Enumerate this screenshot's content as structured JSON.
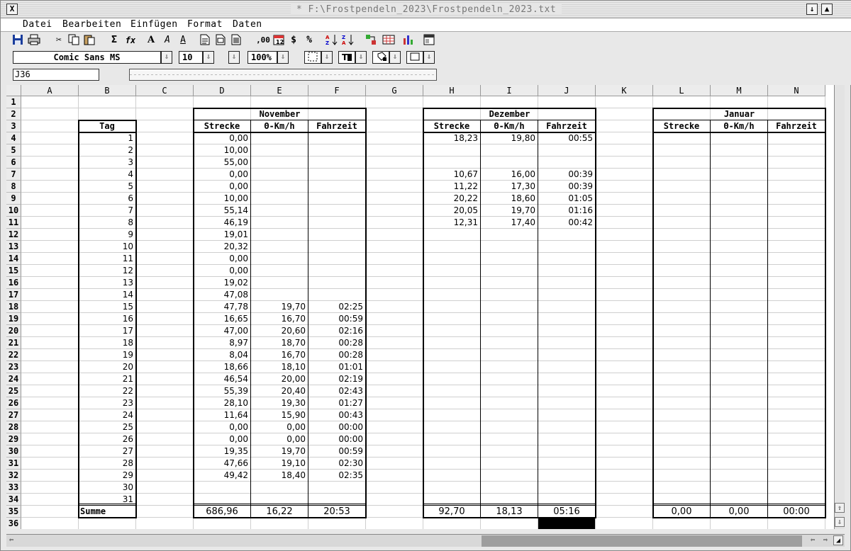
{
  "window": {
    "title": "* F:\\Frostpendeln_2023\\Frostpendeln_2023.txt",
    "close_glyph": "X",
    "iconify_glyph": "↓",
    "fulltoggle_glyph": "▲",
    "resize_glyph": "◢"
  },
  "menubar": [
    "Datei",
    "Bearbeiten",
    "Einfügen",
    "Format",
    "Daten"
  ],
  "toolbar": {
    "icons": [
      "save-icon",
      "print-icon",
      "cut-icon",
      "copy-icon",
      "paste-icon",
      "sum-icon",
      "function-icon",
      "bold-icon",
      "italic-icon",
      "outline-icon",
      "new-sheet-icon",
      "sheet-icon",
      "sheet-list-icon",
      "decimal-icon",
      "date-icon",
      "currency-icon",
      "percent-icon",
      "sort-asc-icon",
      "sort-desc-icon",
      "fill-icon",
      "table-icon",
      "chart-icon",
      "window-icon"
    ],
    "decimal_text": ",00",
    "currency_text": "$",
    "percent_text": "%"
  },
  "formatbar": {
    "font": "Comic Sans MS",
    "size": "10",
    "zoom": "100%",
    "dropdown_arrow": "⇩"
  },
  "cellbar": {
    "cell_ref": "J36",
    "formula": ""
  },
  "columns": [
    "A",
    "B",
    "C",
    "D",
    "E",
    "F",
    "G",
    "H",
    "I",
    "J",
    "K",
    "L",
    "M",
    "N"
  ],
  "rows": [
    "1",
    "2",
    "3",
    "4",
    "5",
    "6",
    "7",
    "8",
    "9",
    "10",
    "11",
    "12",
    "13",
    "14",
    "15",
    "16",
    "17",
    "18",
    "19",
    "20",
    "21",
    "22",
    "23",
    "24",
    "25",
    "26",
    "27",
    "28",
    "29",
    "30",
    "31",
    "32",
    "33",
    "34",
    "35",
    "36"
  ],
  "sheet": {
    "tag_header": "Tag",
    "sum_label": "Summe",
    "tage": [
      "1",
      "2",
      "3",
      "4",
      "5",
      "6",
      "7",
      "8",
      "9",
      "10",
      "11",
      "12",
      "13",
      "14",
      "15",
      "16",
      "17",
      "18",
      "19",
      "20",
      "21",
      "22",
      "23",
      "24",
      "25",
      "26",
      "27",
      "28",
      "29",
      "30",
      "31"
    ],
    "months": [
      {
        "name": "November",
        "headers": [
          "Strecke",
          "Θ-Km/h",
          "Fahrzeit"
        ],
        "rows": [
          [
            "0,00",
            "",
            ""
          ],
          [
            "10,00",
            "",
            ""
          ],
          [
            "55,00",
            "",
            ""
          ],
          [
            "0,00",
            "",
            ""
          ],
          [
            "0,00",
            "",
            ""
          ],
          [
            "10,00",
            "",
            ""
          ],
          [
            "55,14",
            "",
            ""
          ],
          [
            "46,19",
            "",
            ""
          ],
          [
            "19,01",
            "",
            ""
          ],
          [
            "20,32",
            "",
            ""
          ],
          [
            "0,00",
            "",
            ""
          ],
          [
            "0,00",
            "",
            ""
          ],
          [
            "19,02",
            "",
            ""
          ],
          [
            "47,08",
            "",
            ""
          ],
          [
            "47,78",
            "19,70",
            "02:25"
          ],
          [
            "16,65",
            "16,70",
            "00:59"
          ],
          [
            "47,00",
            "20,60",
            "02:16"
          ],
          [
            "8,97",
            "18,70",
            "00:28"
          ],
          [
            "8,04",
            "16,70",
            "00:28"
          ],
          [
            "18,66",
            "18,10",
            "01:01"
          ],
          [
            "46,54",
            "20,00",
            "02:19"
          ],
          [
            "55,39",
            "20,40",
            "02:43"
          ],
          [
            "28,10",
            "19,30",
            "01:27"
          ],
          [
            "11,64",
            "15,90",
            "00:43"
          ],
          [
            "0,00",
            "0,00",
            "00:00"
          ],
          [
            "0,00",
            "0,00",
            "00:00"
          ],
          [
            "19,35",
            "19,70",
            "00:59"
          ],
          [
            "47,66",
            "19,10",
            "02:30"
          ],
          [
            "49,42",
            "18,40",
            "02:35"
          ],
          [
            "",
            "",
            ""
          ],
          [
            "",
            "",
            ""
          ]
        ],
        "sum": [
          "686,96",
          "16,22",
          "20:53"
        ]
      },
      {
        "name": "Dezember",
        "headers": [
          "Strecke",
          "Θ-Km/h",
          "Fahrzeit"
        ],
        "rows": [
          [
            "18,23",
            "19,80",
            "00:55"
          ],
          [
            "",
            "",
            ""
          ],
          [
            "",
            "",
            ""
          ],
          [
            "10,67",
            "16,00",
            "00:39"
          ],
          [
            "11,22",
            "17,30",
            "00:39"
          ],
          [
            "20,22",
            "18,60",
            "01:05"
          ],
          [
            "20,05",
            "19,70",
            "01:16"
          ],
          [
            "12,31",
            "17,40",
            "00:42"
          ]
        ],
        "sum": [
          "92,70",
          "18,13",
          "05:16"
        ]
      },
      {
        "name": "Januar",
        "headers": [
          "Strecke",
          "Θ-Km/h",
          "Fahrzeit"
        ],
        "rows": [],
        "sum": [
          "0,00",
          "0,00",
          "00:00"
        ]
      }
    ]
  },
  "scroll": {
    "up": "⇧",
    "down": "⇩",
    "left": "⇦",
    "right": "⇨",
    "horizontal_thumb_fraction": 0.38
  }
}
